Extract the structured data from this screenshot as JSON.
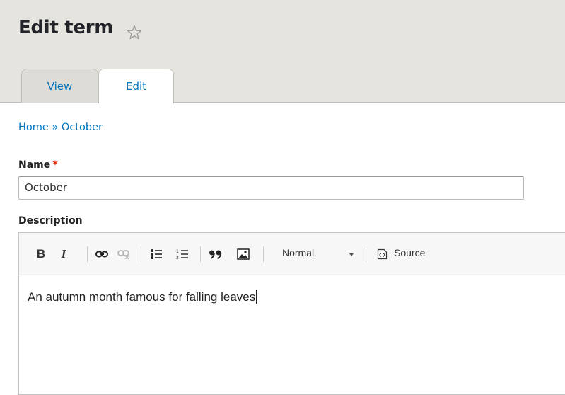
{
  "header": {
    "title": "Edit term",
    "star_icon": "star-outline-icon",
    "tabs": [
      {
        "label": "View",
        "active": false
      },
      {
        "label": "Edit",
        "active": true
      }
    ]
  },
  "breadcrumb": {
    "home": "Home",
    "separator": "»",
    "current": "October"
  },
  "form": {
    "name_label": "Name",
    "required_marker": "*",
    "name_value": "October",
    "description_label": "Description"
  },
  "editor": {
    "toolbar": {
      "bold_label": "B",
      "italic_label": "I",
      "icons": [
        "link-icon",
        "unlink-icon",
        "bulleted-list-icon",
        "numbered-list-icon",
        "blockquote-icon",
        "image-icon",
        "source-icon"
      ],
      "format_value": "Normal",
      "source_label": "Source"
    },
    "content": "An autumn month famous for falling leaves"
  },
  "colors": {
    "header_bg": "#e6e4df",
    "link": "#0074bd",
    "required": "#e32700"
  }
}
